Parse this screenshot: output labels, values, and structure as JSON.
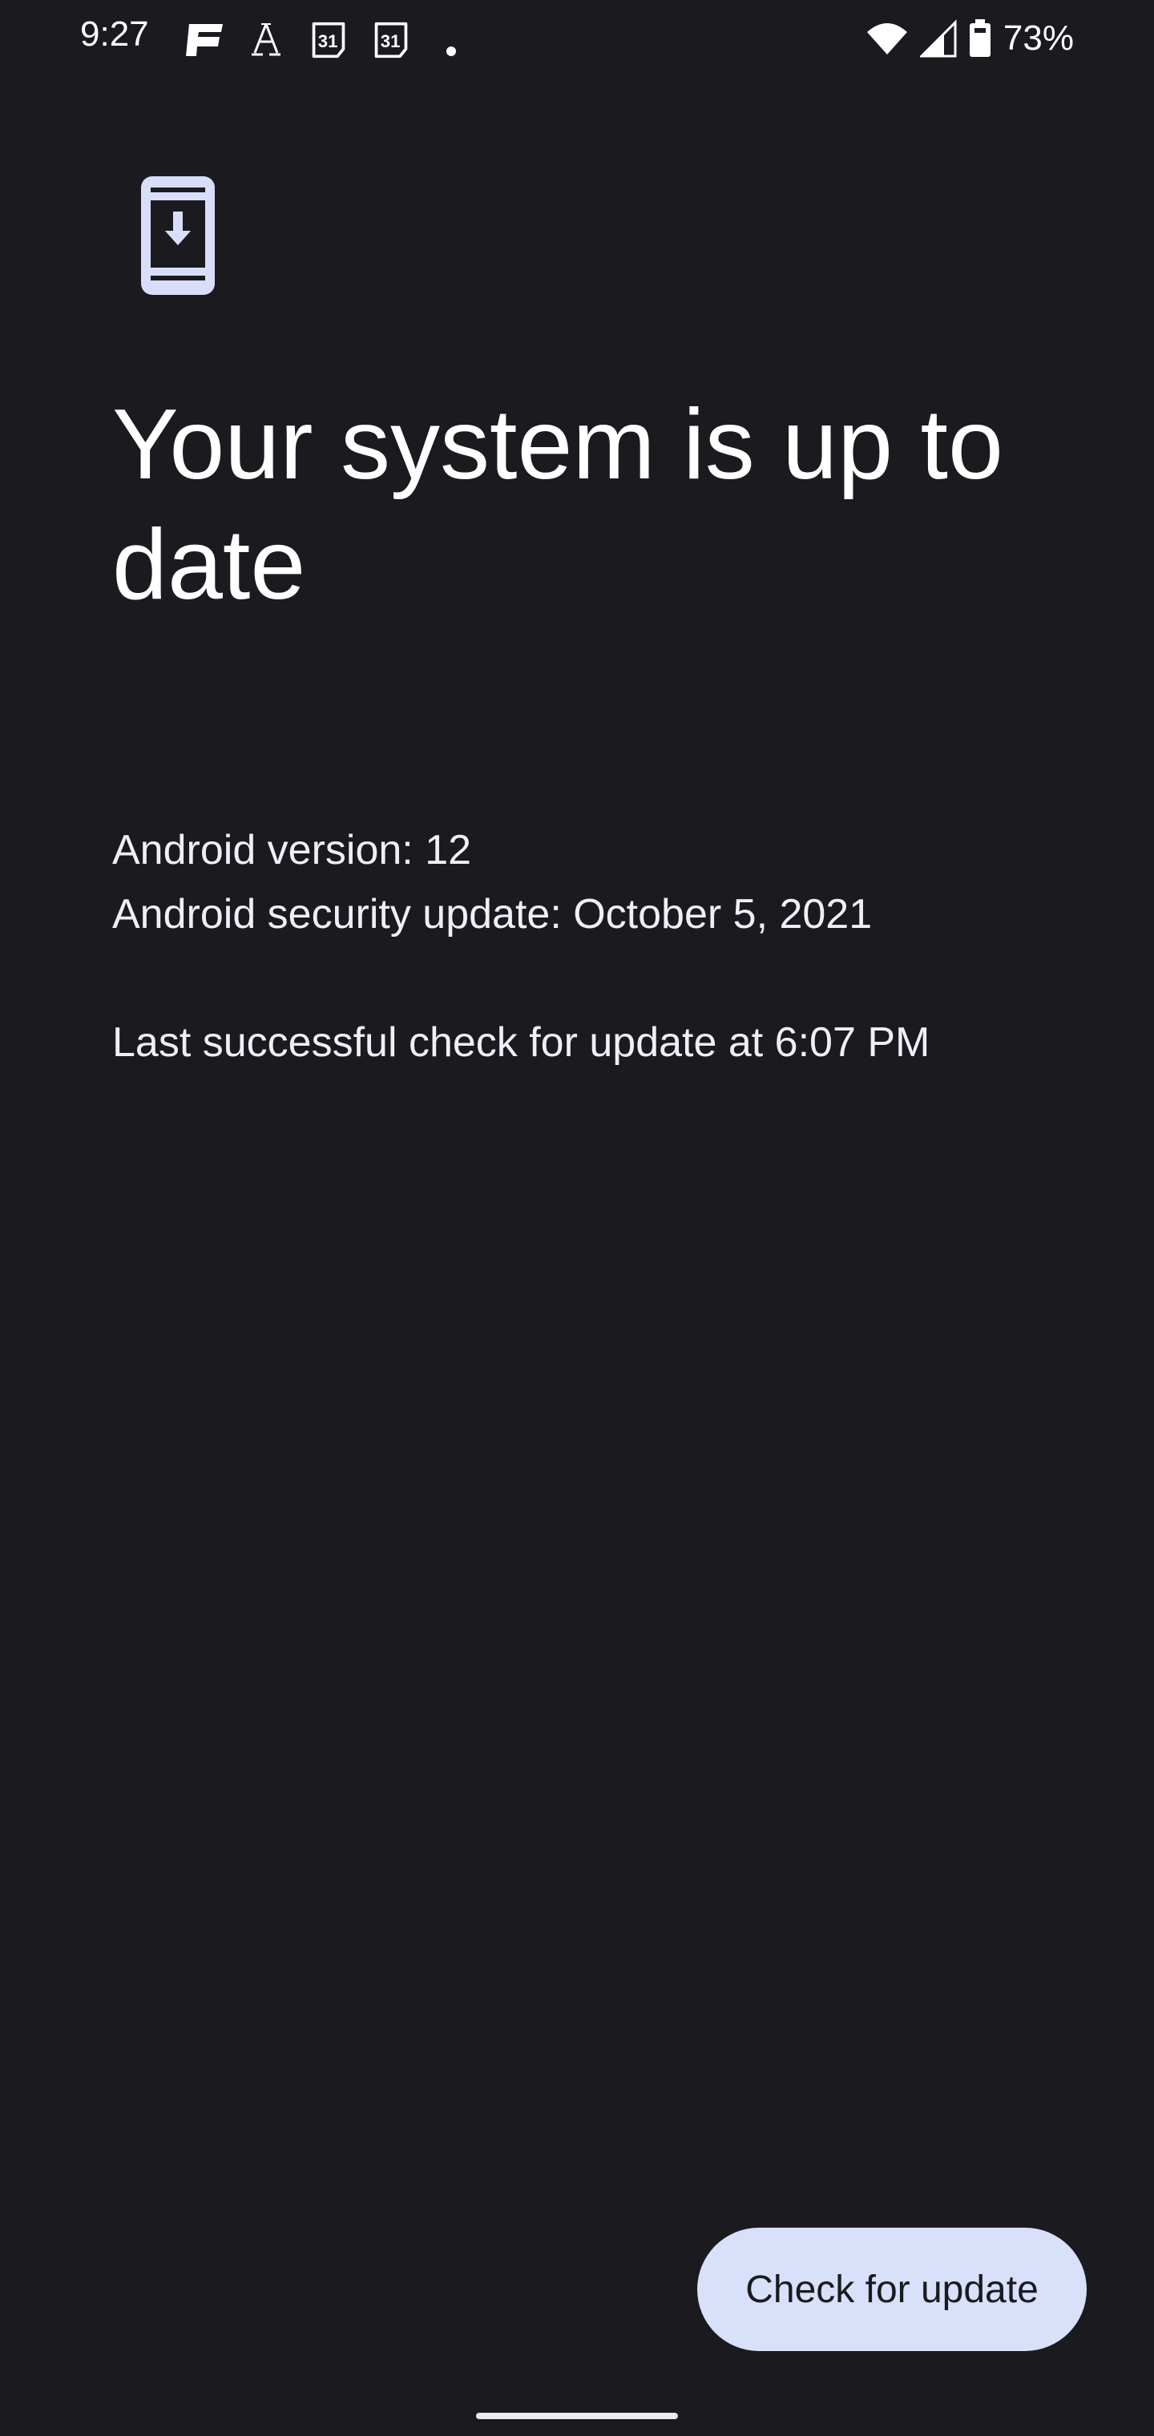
{
  "status_bar": {
    "time": "9:27",
    "notification_icons": [
      "espn-icon",
      "font-a-icon",
      "calendar-31-icon",
      "calendar-31-icon",
      "more-dot-icon"
    ],
    "calendar_day": "31",
    "battery_percent": "73%",
    "system_icons": [
      "wifi-icon",
      "cellular-signal-icon",
      "battery-icon"
    ]
  },
  "page": {
    "icon": "system-update-icon",
    "title": "Your system is up to date",
    "android_version": "Android version: 12",
    "security_update": "Android security update: October 5, 2021",
    "last_check": "Last successful check for update at 6:07 PM"
  },
  "actions": {
    "check_for_update_label": "Check for update"
  },
  "colors": {
    "background": "#1b1b1f",
    "accent": "#d8e0fa",
    "icon_tint": "#d8defa"
  }
}
